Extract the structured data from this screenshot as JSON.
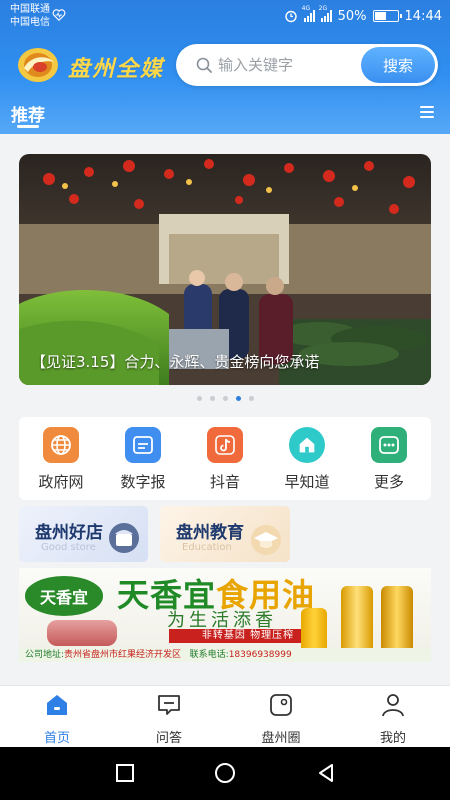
{
  "status_bar": {
    "carrier1": "中国联通",
    "carrier2": "中国电信",
    "net1": "4G",
    "net2": "2G",
    "battery": "50%",
    "battery_level": 0.5,
    "time": "14:44"
  },
  "header": {
    "brand": "盘州全媒",
    "search_placeholder": "输入关键字",
    "search_button": "搜索"
  },
  "tabs": {
    "active": "推荐"
  },
  "banner": {
    "caption": "【见证3.15】合力、永辉、贵金榜向您承诺",
    "dot_count": 5,
    "active_dot": 3
  },
  "quick_links": [
    {
      "label": "政府网",
      "icon": "globe-icon",
      "color": "#f08a3c"
    },
    {
      "label": "数字报",
      "icon": "newspaper-icon",
      "color": "#3f8ef0"
    },
    {
      "label": "抖音",
      "icon": "music-note-icon",
      "color": "#f06a3c"
    },
    {
      "label": "早知道",
      "icon": "home-icon",
      "color": "#2ec9c9"
    },
    {
      "label": "更多",
      "icon": "more-icon",
      "color": "#2fb07a"
    }
  ],
  "cards": [
    {
      "title": "盘州好店",
      "subtitle": "Good store"
    },
    {
      "title": "盘州教育",
      "subtitle": "Education"
    }
  ],
  "ad": {
    "logo_text": "天香宜",
    "headline_green": "天香宜",
    "headline_orange": "食用油",
    "slogan": "为生活添香",
    "tag": "非转基因 物理压榨",
    "address_label": "公司地址:",
    "address": "贵州省盘州市红果经济开发区",
    "phone_label": "联系电话:",
    "phone": "18396938999"
  },
  "bottom_nav": [
    {
      "label": "首页",
      "icon": "home-icon",
      "active": true
    },
    {
      "label": "问答",
      "icon": "chat-icon",
      "active": false
    },
    {
      "label": "盘州圈",
      "icon": "circle-icon",
      "active": false
    },
    {
      "label": "我的",
      "icon": "user-icon",
      "active": false
    }
  ],
  "colors": {
    "primary": "#2f80e6",
    "header_top": "#2b7fe0",
    "brand_yellow": "#ffd84a"
  }
}
